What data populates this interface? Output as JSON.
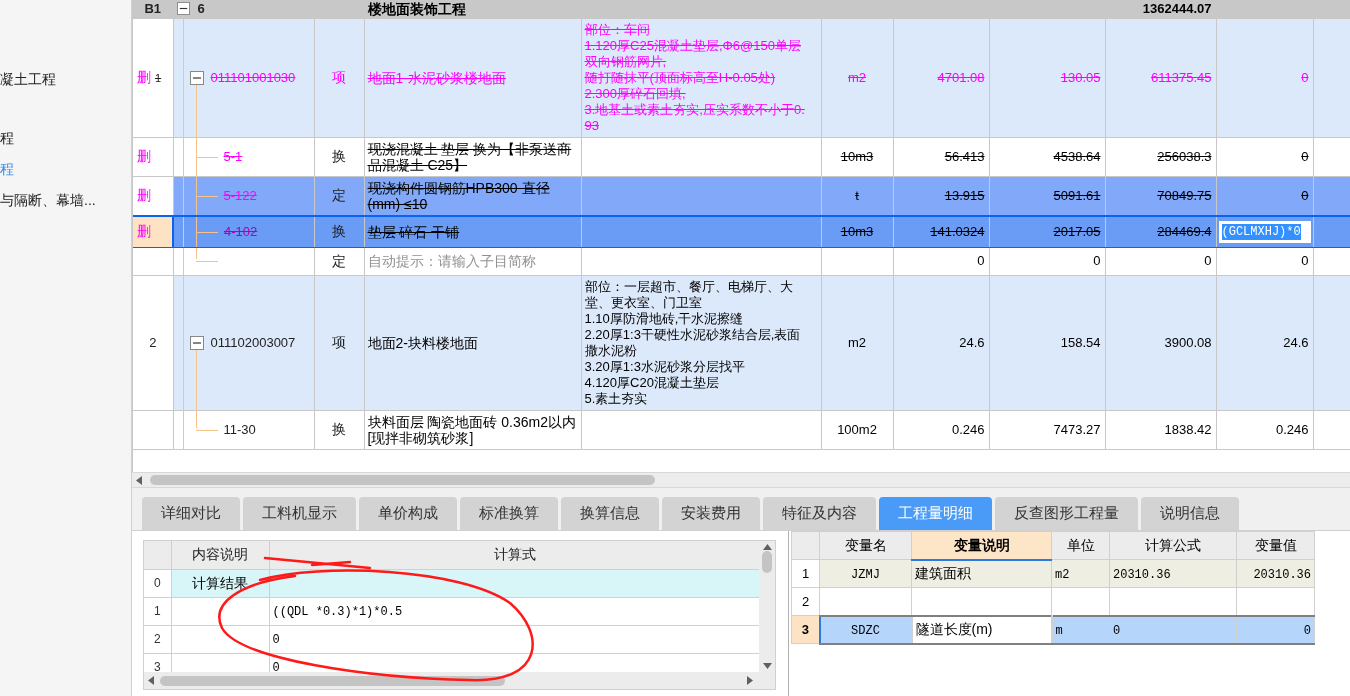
{
  "sidebar": {
    "items": [
      {
        "label": "凝土工程",
        "selected": false
      },
      {
        "label": "程",
        "selected": false
      },
      {
        "label": "程",
        "selected": true
      },
      {
        "label": "与隔断、幕墙...",
        "selected": false
      }
    ]
  },
  "tree_table": {
    "rows": [
      {
        "kind": "group",
        "number": "B1",
        "code": "6",
        "name": "楼地面装饰工程",
        "total": "1362444.07",
        "expanded": true,
        "deleted": false,
        "selected": false,
        "current": false,
        "editing": false
      },
      {
        "kind": "bill",
        "number": "1",
        "mark": "删",
        "code": "011101001030",
        "type": "项",
        "name": "地面1-水泥砂浆楼地面",
        "features": [
          "部位：车间",
          "1.120厚C25混凝土垫层,Φ6@150单层双向钢筋网片,",
          "随打随抹平(顶面标高至H-0.05处)",
          "2.300厚碎石回填,",
          "3.地基土或素土夯实,压实系数不小于0.93"
        ],
        "unit": "m2",
        "quantity": "4701.08",
        "price": "130.05",
        "total": "611375.45",
        "expr": "0",
        "expanded": true,
        "deleted": true,
        "selected": false,
        "current": false,
        "editing": false
      },
      {
        "kind": "sub",
        "mark": "删",
        "code": "5-1",
        "type": "换",
        "name": "现浇混凝土 垫层  换为【非泵送商品混凝土 C25】",
        "unit": "10m3",
        "quantity": "56.413",
        "price": "4538.64",
        "total": "256038.3",
        "expr": "0",
        "deleted": true,
        "selected": false,
        "current": false,
        "editing": false
      },
      {
        "kind": "sub",
        "mark": "删",
        "code": "5-122",
        "type": "定",
        "name": "现浇构件圆钢筋HPB300 直径(mm) ≤10",
        "unit": "t",
        "quantity": "13.915",
        "price": "5091.61",
        "total": "70849.75",
        "expr": "0",
        "deleted": true,
        "selected": true,
        "current": false,
        "editing": false
      },
      {
        "kind": "sub",
        "mark": "删",
        "code": "4-102",
        "type": "换",
        "name": "垫层 碎石 干铺",
        "unit": "10m3",
        "quantity": "141.0324",
        "price": "2017.05",
        "total": "284469.4",
        "expr": "(GCLMXHJ)*0",
        "deleted": true,
        "selected": true,
        "current": true,
        "editing": true
      },
      {
        "kind": "sub",
        "type": "定",
        "placeholder": "自动提示：请输入子目简称",
        "quantity": "0",
        "price": "0",
        "total": "0",
        "expr": "0",
        "deleted": false,
        "selected": false,
        "current": false,
        "editing": false
      },
      {
        "kind": "bill",
        "number": "2",
        "code": "011102003007",
        "type": "项",
        "name": "地面2-块料楼地面",
        "features": [
          "部位：一层超市、餐厅、电梯厅、大堂、更衣室、门卫室",
          "1.10厚防滑地砖,干水泥擦缝",
          "2.20厚1:3干硬性水泥砂浆结合层,表面撒水泥粉",
          "3.20厚1:3水泥砂浆分层找平",
          "4.120厚C20混凝土垫层",
          "5.素土夯实"
        ],
        "unit": "m2",
        "quantity": "24.6",
        "price": "158.54",
        "total": "3900.08",
        "expr": "24.6",
        "expanded": true,
        "deleted": false,
        "selected": false,
        "current": false,
        "editing": false
      },
      {
        "kind": "sub",
        "code": "11-30",
        "type": "换",
        "name": "块料面层 陶瓷地面砖 0.36m2以内 [现拌非砌筑砂浆]",
        "unit": "100m2",
        "quantity": "0.246",
        "price": "7473.27",
        "total": "1838.42",
        "expr": "0.246",
        "deleted": false,
        "selected": false,
        "current": false,
        "editing": false
      }
    ]
  },
  "tabs": [
    {
      "label": "详细对比",
      "selected": false
    },
    {
      "label": "工料机显示",
      "selected": false
    },
    {
      "label": "单价构成",
      "selected": false
    },
    {
      "label": "标准换算",
      "selected": false
    },
    {
      "label": "换算信息",
      "selected": false
    },
    {
      "label": "安装费用",
      "selected": false
    },
    {
      "label": "特征及内容",
      "selected": false
    },
    {
      "label": "工程量明细",
      "selected": true
    },
    {
      "label": "反查图形工程量",
      "selected": false
    },
    {
      "label": "说明信息",
      "selected": false
    }
  ],
  "formula_grid": {
    "columns": [
      "内容说明",
      "计算式"
    ],
    "rows": [
      {
        "kind": "result",
        "number": "0",
        "description": "计算结果"
      },
      {
        "kind": "entry",
        "number": "1",
        "formula": "((QDL *0.3)*1)*0.5"
      },
      {
        "kind": "entry",
        "number": "2",
        "formula": "0"
      },
      {
        "kind": "entry",
        "number": "3",
        "formula": "0"
      }
    ]
  },
  "variable_table": {
    "columns": [
      {
        "label": "变量名",
        "selected": false
      },
      {
        "label": "变量说明",
        "selected": true
      },
      {
        "label": "单位",
        "selected": false
      },
      {
        "label": "计算公式",
        "selected": false
      },
      {
        "label": "变量值",
        "selected": false
      }
    ],
    "rows": [
      {
        "number": "1",
        "name": "JZMJ",
        "description": "建筑面积",
        "unit": "m2",
        "formula": "20310.36",
        "value": "20310.36",
        "readonly": true,
        "selected": false
      },
      {
        "number": "2",
        "readonly": false,
        "selected": false
      },
      {
        "number": "3",
        "name": "SDZC",
        "description": "隧道长度(m)",
        "unit": "m",
        "formula": "0",
        "value": "0",
        "readonly": false,
        "selected": true
      }
    ]
  }
}
